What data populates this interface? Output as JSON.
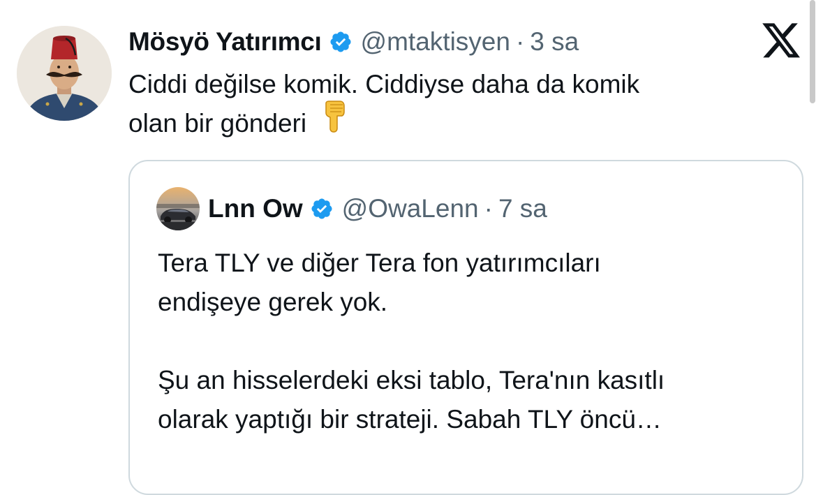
{
  "colors": {
    "verified": "#1d9bf0",
    "secondary_text": "#536471",
    "primary_text": "#0f1419",
    "card_border": "#cfd9de"
  },
  "tweet": {
    "author_name": "Mösyö Yatırımcı",
    "handle": "@mtaktisyen",
    "separator": "·",
    "time": "3 sa",
    "text_line1": "Ciddi değilse komik. Ciddiyse daha da komik",
    "text_line2": "olan bir gönderi",
    "emoji": "backhand-index-pointing-down",
    "avatar_icon": "avatar-fez-man-icon",
    "logo_icon": "x-logo-icon"
  },
  "quoted": {
    "author_name": "Lnn Ow",
    "handle": "@OwaLenn",
    "separator": "·",
    "time": "7 sa",
    "paragraph1_line1": "Tera TLY ve diğer Tera fon yatırımcıları",
    "paragraph1_line2": "endişeye gerek yok.",
    "paragraph2_line1": "Şu an hisselerdeki eksi tablo, Tera'nın kasıtlı",
    "paragraph2_line2": "olarak yaptığı bir strateji. Sabah TLY öncü…",
    "avatar_icon": "avatar-car-icon"
  }
}
